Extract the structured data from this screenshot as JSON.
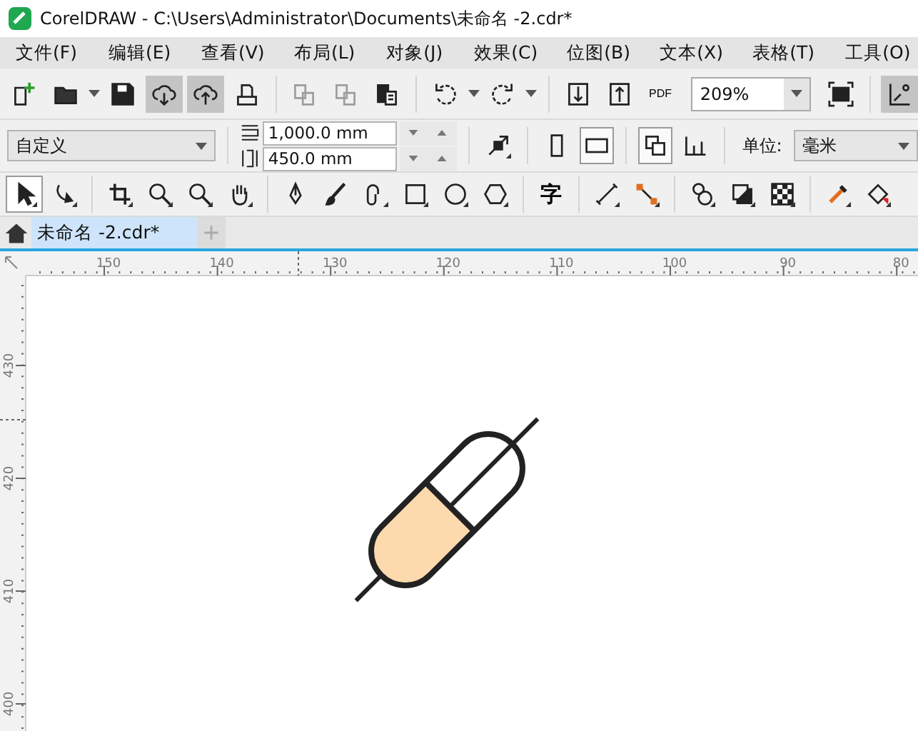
{
  "window": {
    "title": "CorelDRAW - C:\\Users\\Administrator\\Documents\\未命名 -2.cdr*"
  },
  "menu": [
    "文件(F)",
    "编辑(E)",
    "查看(V)",
    "布局(L)",
    "对象(J)",
    "效果(C)",
    "位图(B)",
    "文本(X)",
    "表格(T)",
    "工具(O)"
  ],
  "standard_toolbar": [
    {
      "kind": "button",
      "pressed": false,
      "disabled": false
    },
    {
      "kind": "split",
      "pressed": false,
      "disabled": false
    },
    {
      "kind": "button",
      "pressed": false,
      "disabled": false
    },
    {
      "kind": "button",
      "pressed": true,
      "disabled": false
    },
    {
      "kind": "button",
      "pressed": true,
      "disabled": false
    },
    {
      "kind": "button",
      "pressed": false,
      "disabled": false
    },
    {
      "kind": "separator"
    },
    {
      "kind": "button",
      "pressed": false,
      "disabled": true
    },
    {
      "kind": "button",
      "pressed": false,
      "disabled": true
    },
    {
      "kind": "button",
      "pressed": false,
      "disabled": false
    },
    {
      "kind": "separator"
    },
    {
      "kind": "split",
      "pressed": false,
      "disabled": false
    },
    {
      "kind": "split",
      "pressed": false,
      "disabled": false
    },
    {
      "kind": "separator"
    },
    {
      "kind": "button",
      "pressed": false,
      "disabled": false
    },
    {
      "kind": "button",
      "pressed": false,
      "disabled": false
    },
    {
      "kind": "label_button",
      "label": "PDF",
      "pressed": false,
      "disabled": false
    },
    {
      "kind": "zoom",
      "value": "209%"
    },
    {
      "kind": "button",
      "pressed": false,
      "disabled": false
    },
    {
      "kind": "separator"
    },
    {
      "kind": "button",
      "pressed": true,
      "disabled": false
    }
  ],
  "property_bar": {
    "preset": "自定义",
    "width": "1,000.0 mm",
    "height": "450.0 mm",
    "portrait_selected": false,
    "landscape_selected": true,
    "unit_label": "单位:",
    "unit": "毫米"
  },
  "toolbox": [
    {
      "kind": "tool",
      "selected": true
    },
    {
      "kind": "tool",
      "selected": false
    },
    {
      "kind": "separator"
    },
    {
      "kind": "tool",
      "selected": false
    },
    {
      "kind": "tool",
      "selected": false
    },
    {
      "kind": "tool",
      "selected": false
    },
    {
      "kind": "tool",
      "selected": false
    },
    {
      "kind": "separator"
    },
    {
      "kind": "tool",
      "selected": false
    },
    {
      "kind": "tool",
      "selected": false
    },
    {
      "kind": "tool",
      "selected": false
    },
    {
      "kind": "tool",
      "selected": false
    },
    {
      "kind": "tool",
      "selected": false
    },
    {
      "kind": "tool",
      "selected": false
    },
    {
      "kind": "separator"
    },
    {
      "kind": "text_tool",
      "label": "字",
      "selected": false
    },
    {
      "kind": "separator"
    },
    {
      "kind": "tool",
      "selected": false
    },
    {
      "kind": "tool",
      "selected": false
    },
    {
      "kind": "separator"
    },
    {
      "kind": "tool",
      "selected": false
    },
    {
      "kind": "tool",
      "selected": false
    },
    {
      "kind": "tool",
      "selected": false
    },
    {
      "kind": "separator"
    },
    {
      "kind": "tool",
      "selected": false
    },
    {
      "kind": "tool",
      "selected": false
    }
  ],
  "tabs": [
    {
      "label": "未命名 -2.cdr*",
      "selected": true
    }
  ],
  "horizontal_ruler": [
    "150",
    "140",
    "130",
    "120",
    "110",
    "100",
    "90",
    "80"
  ],
  "vertical_ruler": [
    "430",
    "420",
    "410",
    "400"
  ]
}
